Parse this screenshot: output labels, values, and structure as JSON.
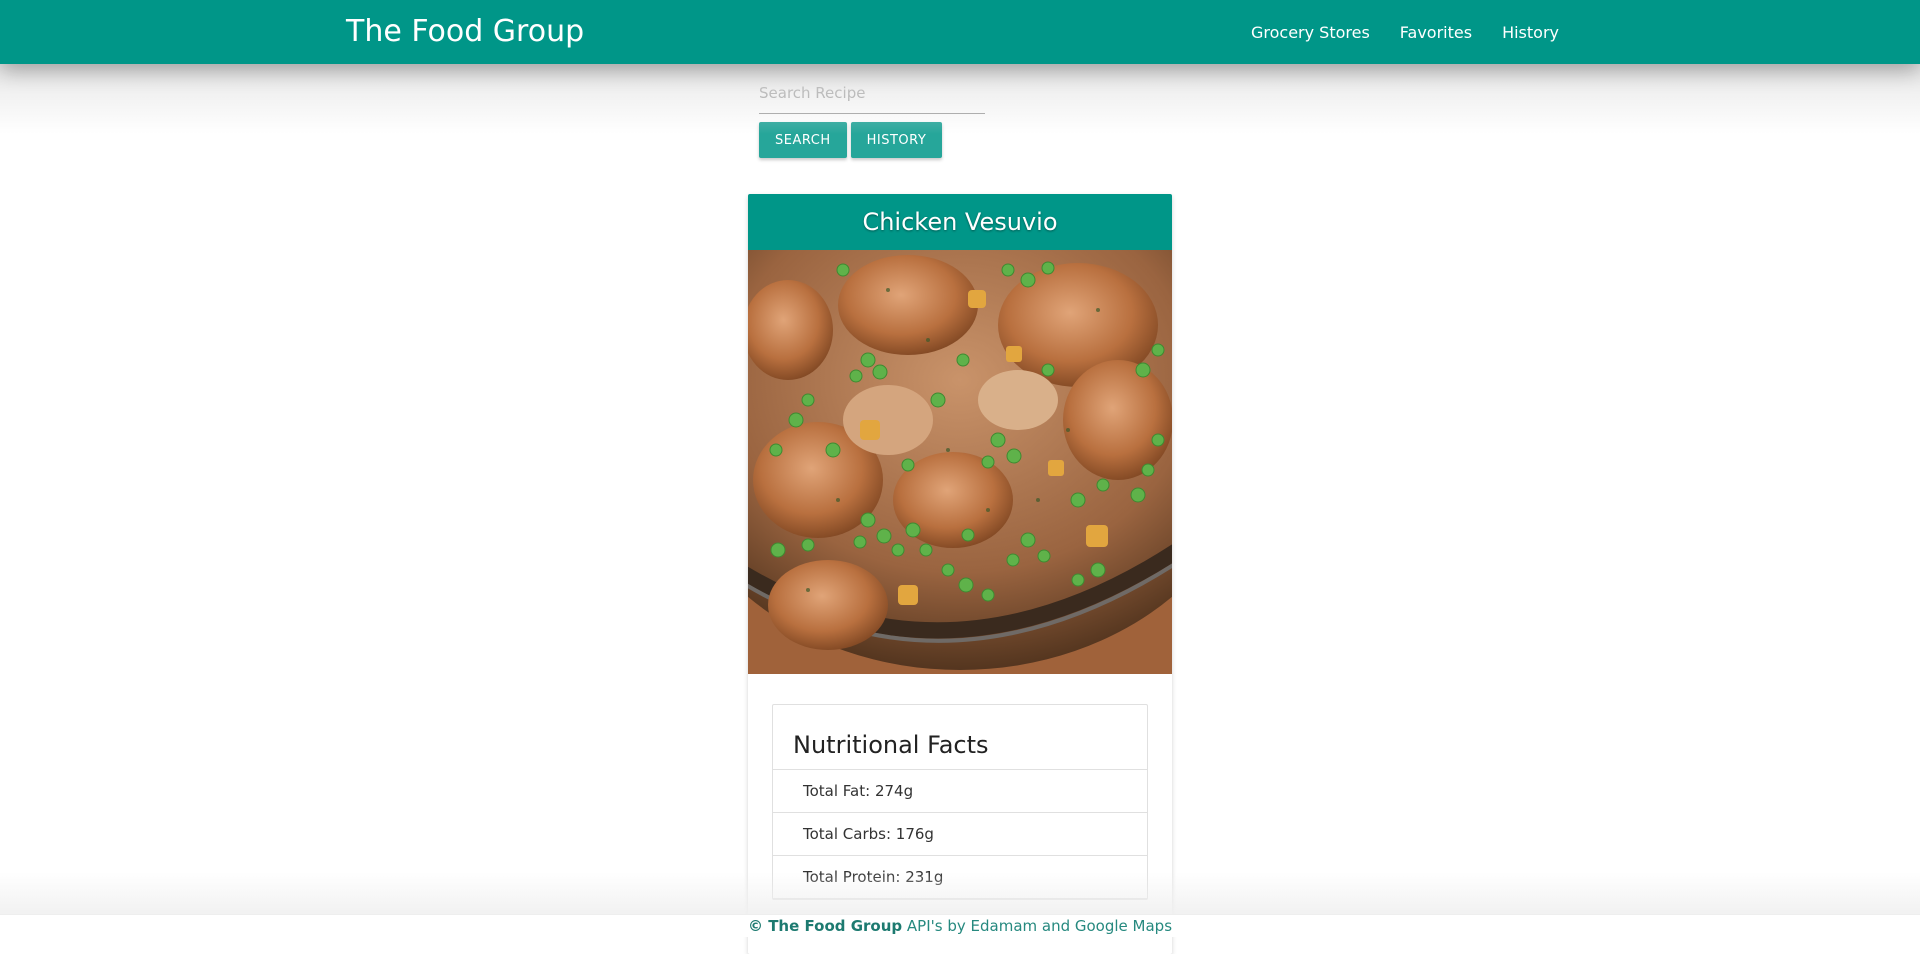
{
  "navbar": {
    "brand": "The Food Group",
    "links": [
      "Grocery Stores",
      "Favorites",
      "History"
    ],
    "background_color": "#009688"
  },
  "search": {
    "placeholder": "Search Recipe",
    "value": "",
    "search_button": "SEARCH",
    "history_button": "HISTORY",
    "button_color": "#26a69a"
  },
  "recipe": {
    "title": "Chicken Vesuvio",
    "image_icon": "recipe-photo",
    "nutrition": {
      "header": "Nutritional Facts",
      "items": [
        "Total Fat: 274g",
        "Total Carbs: 176g",
        "Total Protein: 231g"
      ]
    }
  },
  "footer": {
    "brand": "© The Food Group",
    "text": " API's by Edamam and Google Maps"
  }
}
